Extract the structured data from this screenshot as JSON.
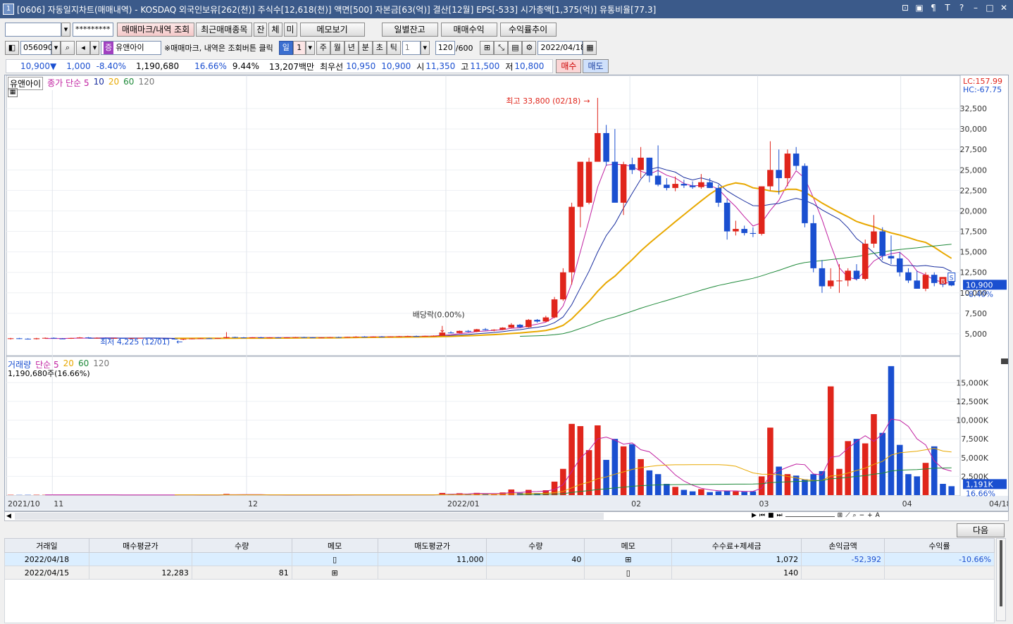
{
  "title": {
    "icon_label": "1",
    "text": "[0606] 자동일지차트(매매내역) - KOSDAQ 외국인보유[262(천)] 주식수[12,618(천)] 액면[500] 자본금[63(억)] 결산[12월] EPS[-533] 시가총액[1,375(억)] 유통비율[77.3]"
  },
  "toolbar1": {
    "account_value": "",
    "password_value": "*********",
    "buttons": [
      "매매마크/내역 조회",
      "최근매매종목",
      "잔",
      "체",
      "미",
      "메모보기",
      "일별잔고",
      "매매수익",
      "수익률추이"
    ]
  },
  "toolbar2": {
    "code": "056090",
    "stock_badge": "증",
    "stock_name": "유앤아이",
    "hint": "※매매마크, 내역은 조회버튼 클릭",
    "periods": [
      "일",
      "1",
      "주",
      "월",
      "년",
      "분",
      "초",
      "틱",
      "1"
    ],
    "count": "120",
    "count_total": "/600",
    "date": "2022/04/18"
  },
  "quote": {
    "price": "10,900",
    "change": "1,000",
    "change_pct": "-8.40%",
    "volume": "1,190,680",
    "volume_pct": "16.66%",
    "turnover": "9.44%",
    "amount": "13,207백만",
    "best_label": "최우선",
    "best_ask": "10,950",
    "best_bid": "10,900",
    "open_label": "시",
    "open": "11,350",
    "high_label": "고",
    "high": "11,500",
    "low_label": "저",
    "low": "10,800",
    "buy": "매수",
    "sell": "매도"
  },
  "chart_legend": {
    "stock_name": "유앤아이",
    "price_ma": "종가 단순 5",
    "ma_periods": [
      "10",
      "20",
      "60",
      "120"
    ],
    "lc": "LC:157.99",
    "hc": "HC:-67.75",
    "high_annotation": "최고 33,800 (02/18)",
    "low_annotation": "최저 4,225 (12/01)",
    "dividend_annotation": "배당락(0.00%)",
    "price_tag": "10,900",
    "price_tag_pct": "-8.40%",
    "volume_label": "거래량",
    "volume_ma": "단순 5",
    "volume_summary": "1,190,680주(16.66%)",
    "volume_tag": "1,191K",
    "volume_tag_pct": "16.66%",
    "next_button": "다음"
  },
  "chart_data": {
    "type": "candlestick",
    "price_axis": [
      "32,500",
      "30,000",
      "27,500",
      "25,000",
      "22,500",
      "20,000",
      "17,500",
      "15,000",
      "12,500",
      "10,000",
      "7,500",
      "5,000"
    ],
    "volume_axis": [
      "15,000K",
      "12,500K",
      "10,000K",
      "7,500K",
      "5,000K",
      "2,500K"
    ],
    "date_labels": [
      "2021/10",
      "11",
      "12",
      "2022/01",
      "02",
      "03",
      "04",
      "04/18"
    ],
    "ylim": [
      2500,
      35000
    ],
    "vol_ylim": [
      0,
      17000
    ],
    "colors": {
      "up": "#e0251b",
      "down": "#1a4fd0",
      "ma5": "#c01fa0",
      "ma10": "#1a2fa0",
      "ma20": "#e8a800",
      "ma60": "#1f8a3a",
      "ma120": "#777777"
    },
    "candles": [
      [
        4400,
        4500,
        4300,
        4450,
        40
      ],
      [
        4450,
        4500,
        4350,
        4400,
        30
      ],
      [
        4400,
        4450,
        4300,
        4350,
        35
      ],
      [
        4350,
        4500,
        4300,
        4450,
        45
      ],
      [
        4450,
        4550,
        4400,
        4500,
        38
      ],
      [
        4500,
        4550,
        4400,
        4420,
        30
      ],
      [
        4420,
        4480,
        4350,
        4400,
        28
      ],
      [
        4400,
        4500,
        4380,
        4480,
        35
      ],
      [
        4480,
        4600,
        4450,
        4550,
        50
      ],
      [
        4550,
        4600,
        4450,
        4480,
        40
      ],
      [
        4480,
        4550,
        4400,
        4500,
        32
      ],
      [
        4500,
        4550,
        4420,
        4450,
        30
      ],
      [
        4450,
        4500,
        4400,
        4480,
        28
      ],
      [
        4480,
        4520,
        4400,
        4430,
        30
      ],
      [
        4430,
        4500,
        4380,
        4470,
        33
      ],
      [
        4470,
        4520,
        4420,
        4500,
        35
      ],
      [
        4500,
        4550,
        4450,
        4480,
        30
      ],
      [
        4480,
        4520,
        4400,
        4420,
        31
      ],
      [
        4420,
        4480,
        4350,
        4400,
        29
      ],
      [
        4400,
        4450,
        4300,
        4320,
        35
      ],
      [
        4320,
        4400,
        4225,
        4380,
        40
      ],
      [
        4380,
        4450,
        4330,
        4420,
        30
      ],
      [
        4420,
        4480,
        4380,
        4450,
        28
      ],
      [
        4450,
        4500,
        4400,
        4430,
        27
      ],
      [
        4430,
        4500,
        4400,
        4480,
        29
      ],
      [
        4480,
        5200,
        4450,
        4600,
        160
      ],
      [
        4600,
        4650,
        4500,
        4550,
        60
      ],
      [
        4550,
        4600,
        4480,
        4520,
        40
      ],
      [
        4520,
        4580,
        4480,
        4560,
        35
      ],
      [
        4560,
        4620,
        4500,
        4520,
        33
      ],
      [
        4520,
        4580,
        4480,
        4550,
        30
      ],
      [
        4550,
        4600,
        4500,
        4530,
        31
      ],
      [
        4530,
        4580,
        4480,
        4560,
        30
      ],
      [
        4560,
        4620,
        4520,
        4590,
        34
      ],
      [
        4590,
        4640,
        4540,
        4560,
        32
      ],
      [
        4560,
        4600,
        4500,
        4520,
        30
      ],
      [
        4520,
        4580,
        4480,
        4550,
        29
      ],
      [
        4550,
        4620,
        4520,
        4600,
        33
      ],
      [
        4600,
        4650,
        4550,
        4580,
        30
      ],
      [
        4580,
        4640,
        4550,
        4620,
        35
      ],
      [
        4620,
        4700,
        4580,
        4650,
        40
      ],
      [
        4650,
        4700,
        4600,
        4620,
        34
      ],
      [
        4620,
        4680,
        4580,
        4660,
        33
      ],
      [
        4660,
        4720,
        4620,
        4640,
        31
      ],
      [
        4640,
        4700,
        4600,
        4680,
        36
      ],
      [
        4680,
        4740,
        4640,
        4700,
        38
      ],
      [
        4700,
        4760,
        4660,
        4720,
        37
      ],
      [
        4720,
        4780,
        4680,
        4700,
        35
      ],
      [
        4700,
        4760,
        4660,
        4740,
        39
      ],
      [
        4740,
        4800,
        4700,
        4760,
        40
      ],
      [
        4760,
        5200,
        4740,
        5150,
        290
      ],
      [
        5150,
        5300,
        5050,
        5100,
        150
      ],
      [
        5100,
        5400,
        5050,
        5350,
        250
      ],
      [
        5350,
        5450,
        5200,
        5250,
        120
      ],
      [
        5250,
        5600,
        5200,
        5550,
        300
      ],
      [
        5550,
        5700,
        5400,
        5450,
        200
      ],
      [
        5450,
        5550,
        5300,
        5500,
        150
      ],
      [
        5500,
        5800,
        5450,
        5750,
        350
      ],
      [
        5750,
        6300,
        5700,
        6100,
        750
      ],
      [
        6100,
        6200,
        5700,
        5800,
        300
      ],
      [
        5800,
        6800,
        5750,
        6700,
        700
      ],
      [
        6700,
        6800,
        6350,
        6500,
        280
      ],
      [
        6500,
        7200,
        6450,
        7000,
        650
      ],
      [
        7000,
        9500,
        6900,
        9200,
        1800
      ],
      [
        9200,
        13000,
        9000,
        12500,
        3500
      ],
      [
        12500,
        21000,
        11000,
        20500,
        9500
      ],
      [
        20500,
        21000,
        18000,
        26000,
        9200
      ],
      [
        21000,
        26500,
        20800,
        26000,
        6000
      ],
      [
        26000,
        33800,
        26200,
        29500,
        9300
      ],
      [
        29500,
        30500,
        25500,
        26000,
        4700
      ],
      [
        26000,
        30000,
        24000,
        21000,
        7500
      ],
      [
        21000,
        26000,
        19500,
        25700,
        6500
      ],
      [
        25700,
        26500,
        24500,
        25000,
        6800
      ],
      [
        25000,
        27800,
        24000,
        26500,
        4800
      ],
      [
        26500,
        26500,
        23500,
        24300,
        3300
      ],
      [
        24300,
        28000,
        23000,
        23200,
        2800
      ],
      [
        23200,
        24000,
        22500,
        22800,
        1500
      ],
      [
        22800,
        24200,
        22400,
        23300,
        1100
      ],
      [
        23300,
        23800,
        22800,
        23100,
        700
      ],
      [
        23100,
        23600,
        22700,
        22900,
        500
      ],
      [
        22900,
        24500,
        22700,
        23500,
        800
      ],
      [
        23500,
        24000,
        22800,
        22800,
        400
      ],
      [
        22800,
        23200,
        20500,
        21000,
        500
      ],
      [
        21000,
        21500,
        16500,
        17500,
        600
      ],
      [
        17500,
        18800,
        17000,
        17800,
        500
      ],
      [
        17800,
        18200,
        17000,
        17300,
        450
      ],
      [
        17300,
        18000,
        16800,
        17200,
        500
      ],
      [
        17200,
        23000,
        17000,
        23000,
        2500
      ],
      [
        23000,
        28500,
        22500,
        25000,
        9000
      ],
      [
        25000,
        27500,
        22000,
        24000,
        3800
      ],
      [
        24000,
        27500,
        23000,
        27000,
        2800
      ],
      [
        27000,
        27800,
        25000,
        25500,
        2600
      ],
      [
        25500,
        25800,
        18000,
        18500,
        2100
      ],
      [
        18500,
        19500,
        12500,
        13000,
        2800
      ],
      [
        13000,
        14000,
        10000,
        10800,
        3200
      ],
      [
        10800,
        13000,
        10500,
        11500,
        14500
      ],
      [
        11500,
        13500,
        10000,
        11500,
        3500
      ],
      [
        11500,
        13000,
        10800,
        12700,
        7200
      ],
      [
        12700,
        13500,
        11500,
        11700,
        7500
      ],
      [
        11700,
        16500,
        11500,
        16000,
        6900
      ],
      [
        16000,
        19500,
        15500,
        17500,
        10800
      ],
      [
        17500,
        18000,
        14000,
        14500,
        8300
      ],
      [
        14500,
        17000,
        13500,
        14200,
        17200
      ],
      [
        14200,
        15000,
        12000,
        12500,
        6700
      ],
      [
        12500,
        13000,
        11200,
        11500,
        2800
      ],
      [
        11500,
        12700,
        10500,
        10500,
        2500
      ],
      [
        10500,
        12500,
        10200,
        12200,
        4300
      ],
      [
        12200,
        12500,
        10800,
        11200,
        6500
      ],
      [
        11200,
        11800,
        10700,
        11000,
        1500
      ],
      [
        11350,
        11500,
        10800,
        10900,
        1190
      ]
    ]
  },
  "trade_table": {
    "headers": [
      "거래일",
      "매수평균가",
      "수량",
      "메모",
      "매도평균가",
      "수량",
      "메모",
      "수수료+제세금",
      "손익금액",
      "수익률"
    ],
    "rows": [
      [
        "2022/04/18",
        "",
        "",
        "",
        "11,000",
        "40",
        "",
        "1,072",
        "-52,392",
        "-10.66%"
      ],
      [
        "2022/04/15",
        "12,283",
        "81",
        "",
        "",
        "",
        "",
        "140",
        "",
        ""
      ]
    ]
  }
}
